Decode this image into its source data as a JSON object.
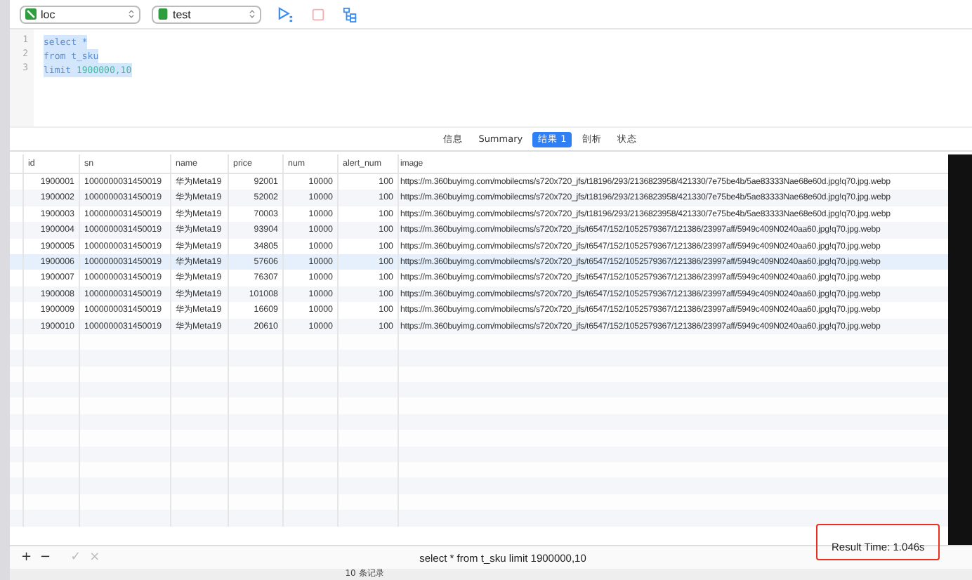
{
  "toolbar": {
    "connection": {
      "name": "loc"
    },
    "database": {
      "name": "test"
    }
  },
  "editor": {
    "selected": true,
    "lines": [
      {
        "number": "1",
        "tokens": [
          {
            "text": "select *",
            "kind": "keyword"
          }
        ]
      },
      {
        "number": "2",
        "tokens": [
          {
            "text": "from t_sku",
            "kind": "keyword"
          }
        ]
      },
      {
        "number": "3",
        "tokens": [
          {
            "text": "limit ",
            "kind": "keyword"
          },
          {
            "text": "1900000,10",
            "kind": "number"
          }
        ]
      }
    ]
  },
  "result_tabs": [
    {
      "label": "信息",
      "selected": false
    },
    {
      "label": "Summary",
      "selected": false
    },
    {
      "label": "结果 1",
      "selected": true
    },
    {
      "label": "剖析",
      "selected": false
    },
    {
      "label": "状态",
      "selected": false
    }
  ],
  "table": {
    "columns": [
      "id",
      "sn",
      "name",
      "price",
      "num",
      "alert_num",
      "image"
    ],
    "rows": [
      {
        "selected": false,
        "cells": [
          "1900001",
          "1000000031450019",
          "华为Meta19",
          "92001",
          "10000",
          "100",
          "https://m.360buyimg.com/mobilecms/s720x720_jfs/t18196/293/2136823958/421330/7e75be4b/5ae83333Nae68e60d.jpg!q70.jpg.webp"
        ]
      },
      {
        "selected": false,
        "cells": [
          "1900002",
          "1000000031450019",
          "华为Meta19",
          "52002",
          "10000",
          "100",
          "https://m.360buyimg.com/mobilecms/s720x720_jfs/t18196/293/2136823958/421330/7e75be4b/5ae83333Nae68e60d.jpg!q70.jpg.webp"
        ]
      },
      {
        "selected": false,
        "cells": [
          "1900003",
          "1000000031450019",
          "华为Meta19",
          "70003",
          "10000",
          "100",
          "https://m.360buyimg.com/mobilecms/s720x720_jfs/t18196/293/2136823958/421330/7e75be4b/5ae83333Nae68e60d.jpg!q70.jpg.webp"
        ]
      },
      {
        "selected": false,
        "cells": [
          "1900004",
          "1000000031450019",
          "华为Meta19",
          "93904",
          "10000",
          "100",
          "https://m.360buyimg.com/mobilecms/s720x720_jfs/t6547/152/1052579367/121386/23997aff/5949c409N0240aa60.jpg!q70.jpg.webp"
        ]
      },
      {
        "selected": false,
        "cells": [
          "1900005",
          "1000000031450019",
          "华为Meta19",
          "34805",
          "10000",
          "100",
          "https://m.360buyimg.com/mobilecms/s720x720_jfs/t6547/152/1052579367/121386/23997aff/5949c409N0240aa60.jpg!q70.jpg.webp"
        ]
      },
      {
        "selected": true,
        "cells": [
          "1900006",
          "1000000031450019",
          "华为Meta19",
          "57606",
          "10000",
          "100",
          "https://m.360buyimg.com/mobilecms/s720x720_jfs/t6547/152/1052579367/121386/23997aff/5949c409N0240aa60.jpg!q70.jpg.webp"
        ]
      },
      {
        "selected": false,
        "cells": [
          "1900007",
          "1000000031450019",
          "华为Meta19",
          "76307",
          "10000",
          "100",
          "https://m.360buyimg.com/mobilecms/s720x720_jfs/t6547/152/1052579367/121386/23997aff/5949c409N0240aa60.jpg!q70.jpg.webp"
        ]
      },
      {
        "selected": false,
        "cells": [
          "1900008",
          "1000000031450019",
          "华为Meta19",
          "101008",
          "10000",
          "100",
          "https://m.360buyimg.com/mobilecms/s720x720_jfs/t6547/152/1052579367/121386/23997aff/5949c409N0240aa60.jpg!q70.jpg.webp"
        ]
      },
      {
        "selected": false,
        "cells": [
          "1900009",
          "1000000031450019",
          "华为Meta19",
          "16609",
          "10000",
          "100",
          "https://m.360buyimg.com/mobilecms/s720x720_jfs/t6547/152/1052579367/121386/23997aff/5949c409N0240aa60.jpg!q70.jpg.webp"
        ]
      },
      {
        "selected": false,
        "cells": [
          "1900010",
          "1000000031450019",
          "华为Meta19",
          "20610",
          "10000",
          "100",
          "https://m.360buyimg.com/mobilecms/s720x720_jfs/t6547/152/1052579367/121386/23997aff/5949c409N0240aa60.jpg!q70.jpg.webp"
        ]
      }
    ]
  },
  "footer": {
    "buttons": [
      {
        "label": "+",
        "disabled": false
      },
      {
        "label": "−",
        "disabled": false
      },
      {
        "label": "✓",
        "disabled": true
      },
      {
        "label": "×",
        "disabled": true
      }
    ],
    "query": "select * from t_sku limit 1900000,10",
    "result_time": "Result Time: 1.046s",
    "highlighted": true
  },
  "status_bar": {
    "record_count": "10 条记录"
  }
}
